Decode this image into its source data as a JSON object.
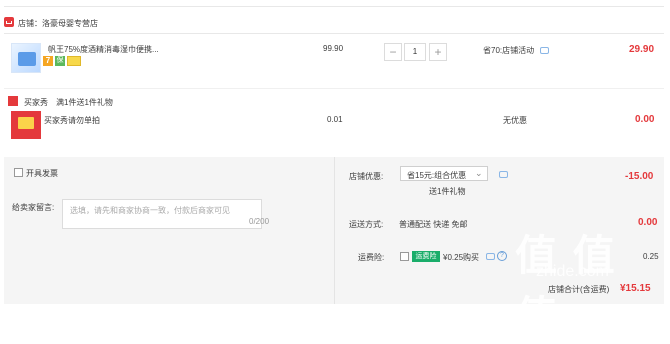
{
  "store": {
    "name": "店铺：洛豪母婴专营店"
  },
  "product": {
    "title": "帆王75%度酒精消毒湿巾便携...",
    "badge_seven": "7",
    "badge_green": "保",
    "price": "99.90",
    "qty": "1",
    "minus": "−",
    "plus": "+",
    "promo": "省70:店铺活动",
    "subtotal": "29.90"
  },
  "gift": {
    "label": "买家秀",
    "desc": "满1件送1件礼物",
    "item_title": "买家秀请勿单拍",
    "price": "0.01",
    "promo": "无优惠",
    "subtotal": "0.00"
  },
  "invoice": {
    "label": "开具发票"
  },
  "message": {
    "label": "给卖家留言:",
    "placeholder": "选填，请先和商家协商一致，付款后商家可见",
    "count": "0/200"
  },
  "discount": {
    "label": "店铺优惠:",
    "select": "省15元:组合优惠",
    "note": "送1件礼物",
    "amount": "-15.00"
  },
  "shipping": {
    "label": "运送方式:",
    "value": "普通配送 快递 免邮",
    "amount": "0.00"
  },
  "insurance": {
    "label": "运费险:",
    "tag": "运费险",
    "text": "¥0.25购买",
    "amount": "0.25"
  },
  "total": {
    "label": "店铺合计(含运费)",
    "amount": "¥15.15"
  },
  "watermark": {
    "big": "值 值 值",
    "small": "zhide.com"
  }
}
